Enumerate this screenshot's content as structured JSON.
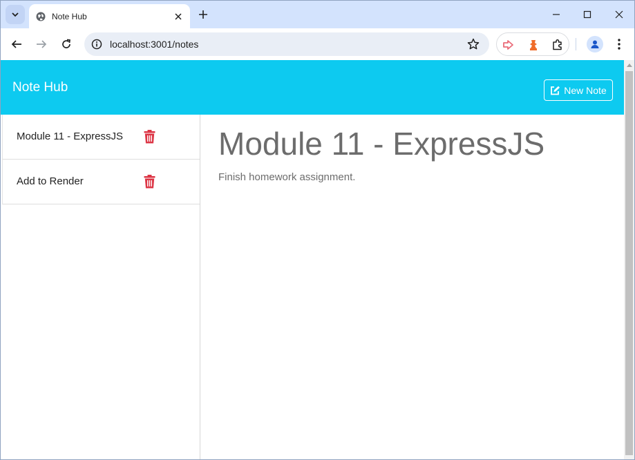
{
  "browser": {
    "tab_title": "Note Hub",
    "url": "localhost:3001/notes",
    "icons": {
      "favicon": "globe-icon",
      "tab_search": "chevron-down-icon",
      "close_tab": "close-icon",
      "new_tab": "plus-icon",
      "minimize": "minimize-icon",
      "maximize": "maximize-icon",
      "close_window": "close-icon",
      "back": "back-arrow-icon",
      "forward": "forward-arrow-icon",
      "reload": "reload-icon",
      "site_info": "info-icon",
      "bookmark": "star-icon",
      "extensions": "puzzle-icon",
      "profile": "person-icon",
      "menu": "kebab-menu-icon"
    },
    "colors": {
      "tabstrip": "#d3e3fd",
      "omnibox": "#e9eef6"
    }
  },
  "app": {
    "brand": "Note Hub",
    "new_note_label": "New Note",
    "colors": {
      "navbar": "#0dcaf0",
      "trash": "#dc3545",
      "heading": "#6c6c6c"
    }
  },
  "notes": [
    {
      "title": "Module 11 - ExpressJS"
    },
    {
      "title": "Add to Render"
    }
  ],
  "active_note": {
    "title": "Module 11 - ExpressJS",
    "text": "Finish homework assignment."
  }
}
